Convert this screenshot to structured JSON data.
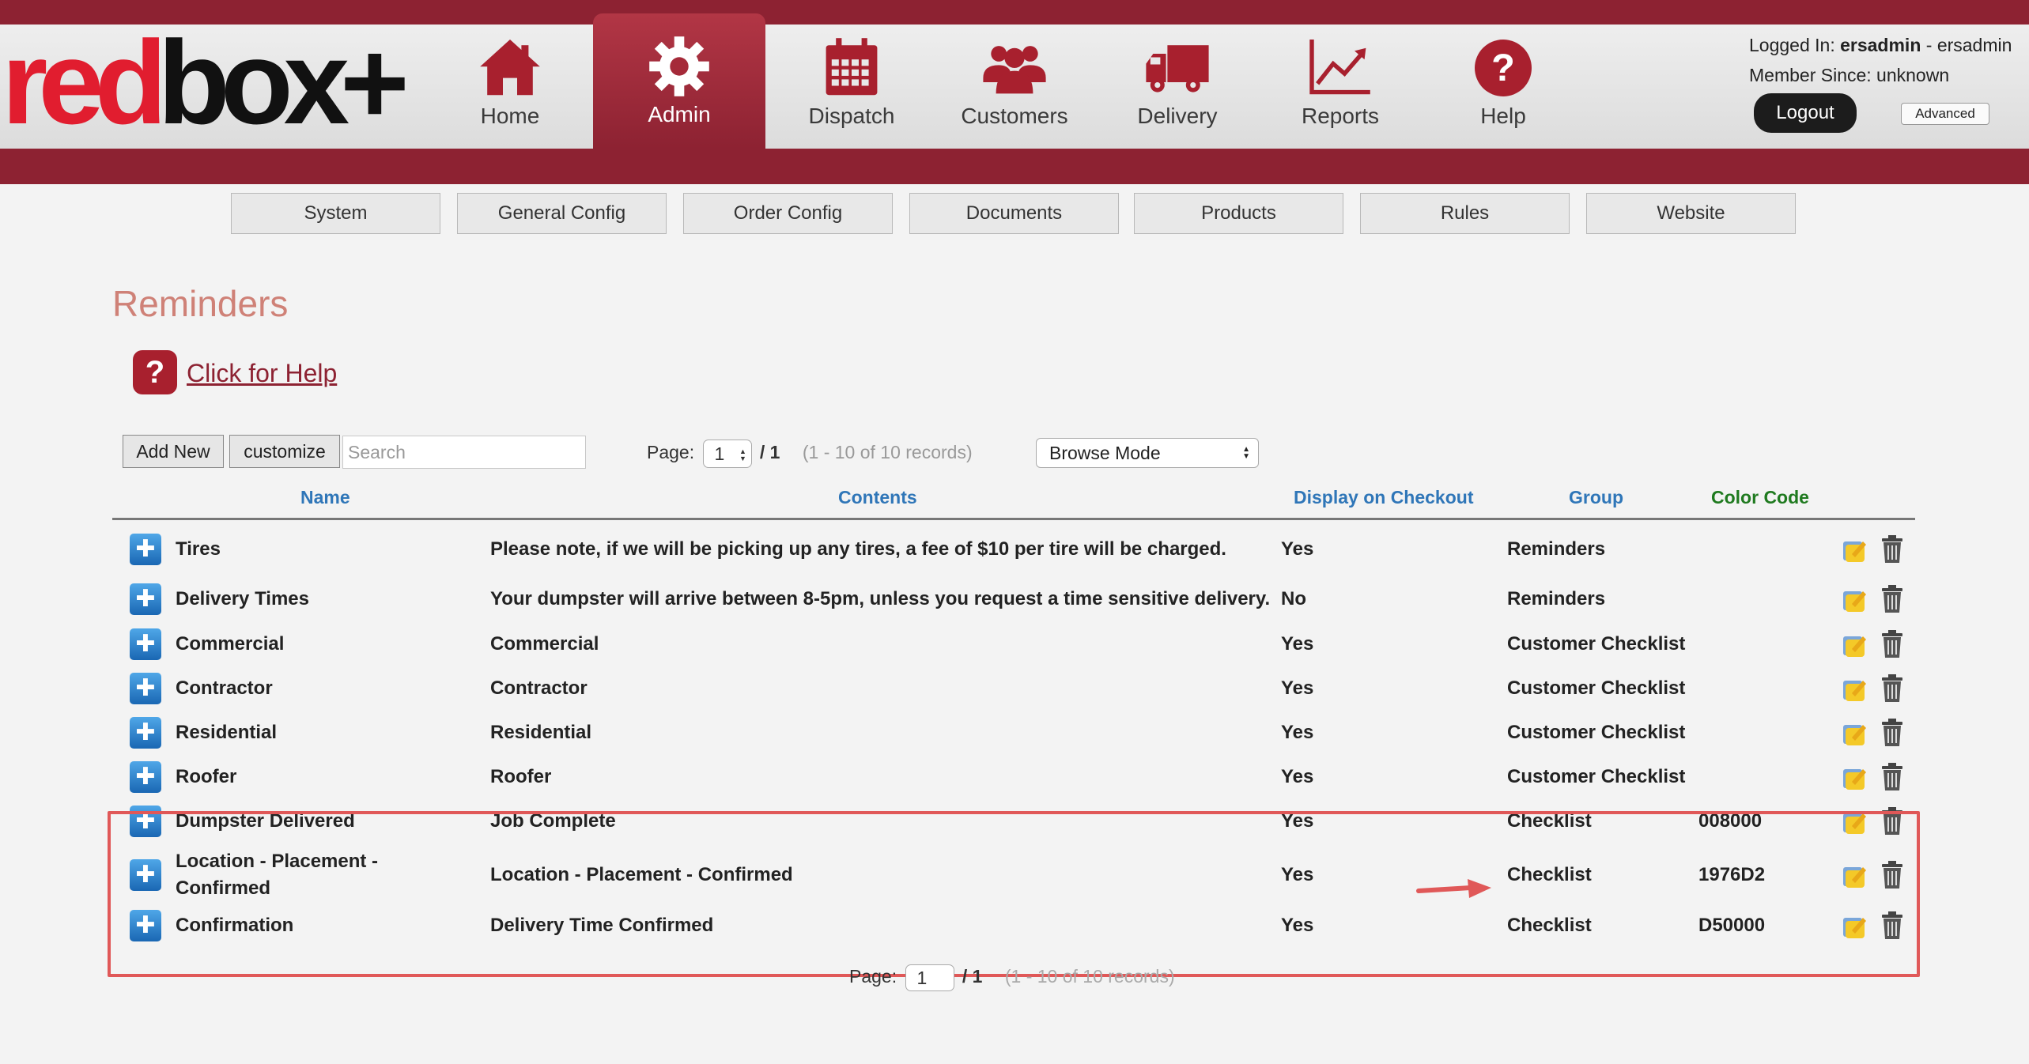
{
  "logo": {
    "part1": "red",
    "part2": "box+"
  },
  "nav": [
    {
      "label": "Home",
      "icon": "home-icon"
    },
    {
      "label": "Admin",
      "icon": "gear-icon"
    },
    {
      "label": "Dispatch",
      "icon": "calendar-icon"
    },
    {
      "label": "Customers",
      "icon": "users-icon"
    },
    {
      "label": "Delivery",
      "icon": "truck-icon"
    },
    {
      "label": "Reports",
      "icon": "chart-icon"
    },
    {
      "label": "Help",
      "icon": "question-icon"
    }
  ],
  "active_nav": "Admin",
  "user": {
    "logged_in_label": "Logged In:",
    "username": "ersadmin",
    "display_name": "- ersadmin",
    "member_since": "Member Since: unknown",
    "logout_label": "Logout",
    "advanced_label": "Advanced"
  },
  "subnav": [
    "System",
    "General Config",
    "Order Config",
    "Documents",
    "Products",
    "Rules",
    "Website"
  ],
  "page": {
    "title": "Reminders",
    "help_link": "Click for Help"
  },
  "toolbar": {
    "add_new": "Add New",
    "customize": "customize",
    "search_placeholder": "Search",
    "page_label": "Page:",
    "page_value": "1",
    "page_total": "/ 1",
    "records": "(1 - 10 of 10 records)",
    "mode": "Browse Mode"
  },
  "table": {
    "columns": {
      "name": "Name",
      "contents": "Contents",
      "display": "Display on Checkout",
      "group": "Group",
      "color": "Color Code"
    },
    "rows": [
      {
        "name": "Tires",
        "contents": "Please note, if we will be picking up any tires, a fee of $10 per tire will be charged.",
        "display": "Yes",
        "group": "Reminders",
        "color": ""
      },
      {
        "name": "Delivery Times",
        "contents": "Your dumpster will arrive between 8-5pm, unless you request a time sensitive delivery.",
        "display": "No",
        "group": "Reminders",
        "color": ""
      },
      {
        "name": "Commercial",
        "contents": "Commercial",
        "display": "Yes",
        "group": "Customer Checklist",
        "color": ""
      },
      {
        "name": "Contractor",
        "contents": "Contractor",
        "display": "Yes",
        "group": "Customer Checklist",
        "color": ""
      },
      {
        "name": "Residential",
        "contents": "Residential",
        "display": "Yes",
        "group": "Customer Checklist",
        "color": ""
      },
      {
        "name": "Roofer",
        "contents": "Roofer",
        "display": "Yes",
        "group": "Customer Checklist",
        "color": ""
      },
      {
        "name": "Dumpster Delivered",
        "contents": "Job Complete",
        "display": "Yes",
        "group": "Checklist",
        "color": "008000"
      },
      {
        "name": "Location - Placement - Confirmed",
        "contents": "Location - Placement - Confirmed",
        "display": "Yes",
        "group": "Checklist",
        "color": "1976D2"
      },
      {
        "name": "Confirmation",
        "contents": "Delivery Time Confirmed",
        "display": "Yes",
        "group": "Checklist",
        "color": "D50000"
      }
    ]
  },
  "bottom_pager": {
    "page_label": "Page:",
    "page_value": "1",
    "page_total": "/ 1",
    "records": "(1 - 10 of 10 records)"
  },
  "colors": {
    "brand": "#8d2232",
    "highlight": "#e05858"
  }
}
